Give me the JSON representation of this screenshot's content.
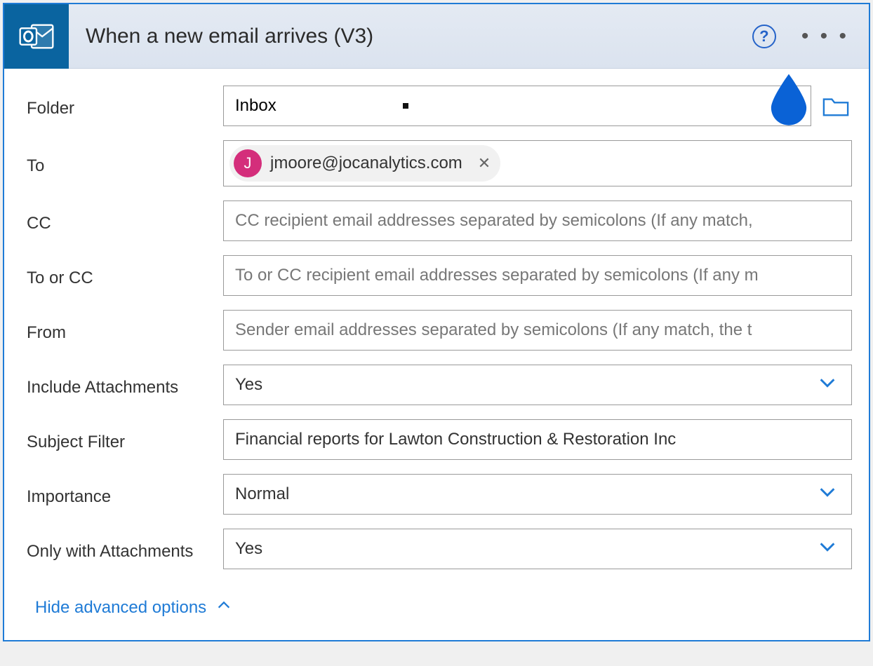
{
  "header": {
    "title": "When a new email arrives (V3)",
    "help": "?",
    "more": "• • •"
  },
  "fields": {
    "folder": {
      "label": "Folder",
      "value": "Inbox"
    },
    "to": {
      "label": "To",
      "pill_initial": "J",
      "pill_email": "jmoore@jocanalytics.com"
    },
    "cc": {
      "label": "CC",
      "placeholder": "CC recipient email addresses separated by semicolons (If any match,"
    },
    "tocc": {
      "label": "To or CC",
      "placeholder": "To or CC recipient email addresses separated by semicolons (If any m"
    },
    "from": {
      "label": "From",
      "placeholder": "Sender email addresses separated by semicolons (If any match, the t"
    },
    "includeAttachments": {
      "label": "Include Attachments",
      "value": "Yes"
    },
    "subjectFilter": {
      "label": "Subject Filter",
      "value": "Financial reports for Lawton Construction & Restoration Inc"
    },
    "importance": {
      "label": "Importance",
      "value": "Normal"
    },
    "onlyWithAttachments": {
      "label": "Only with Attachments",
      "value": "Yes"
    }
  },
  "toggle": "Hide advanced options"
}
